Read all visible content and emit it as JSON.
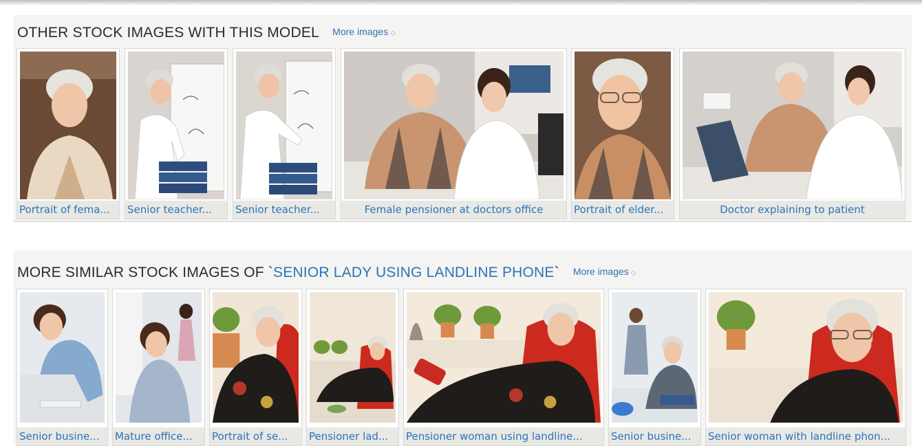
{
  "sections": {
    "other": {
      "heading": "OTHER STOCK IMAGES WITH THIS MODEL",
      "more_label": "More images",
      "tiles": [
        {
          "caption": "Portrait of fema...",
          "icon": "senior-woman-portrait-photo"
        },
        {
          "caption": "Senior teacher...",
          "icon": "teacher-at-whiteboard-photo"
        },
        {
          "caption": "Senior teacher...",
          "icon": "teacher-at-whiteboard-photo"
        },
        {
          "caption": "Female pensioner at doctors office",
          "icon": "patient-and-doctor-photo"
        },
        {
          "caption": "Portrait of elder...",
          "icon": "elderly-woman-portrait-photo"
        },
        {
          "caption": "Doctor explaining to patient",
          "icon": "doctor-with-laptop-photo"
        }
      ]
    },
    "similar": {
      "heading_prefix": "MORE SIMILAR STOCK IMAGES OF `",
      "heading_topic": "SENIOR LADY USING LANDLINE PHONE",
      "heading_suffix": "`",
      "more_label": "More images",
      "tiles": [
        {
          "caption": "Senior busine...",
          "icon": "businesswoman-on-phone-photo"
        },
        {
          "caption": "Mature office...",
          "icon": "office-worker-on-phone-photo"
        },
        {
          "caption": "Portrait of se...",
          "icon": "senior-lady-on-phone-photo"
        },
        {
          "caption": "Pensioner lad...",
          "icon": "pensioner-lady-armchair-photo"
        },
        {
          "caption": "Pensioner woman using landline...",
          "icon": "pensioner-landline-photo"
        },
        {
          "caption": "Senior busine...",
          "icon": "senior-businessman-phone-photo"
        },
        {
          "caption": "Senior woman with landline phon...",
          "icon": "senior-woman-landline-photo"
        }
      ]
    }
  },
  "colors": {
    "link": "#2e73b5",
    "panel": "#f4f4f2",
    "caption_bg": "#e8e8e5"
  }
}
